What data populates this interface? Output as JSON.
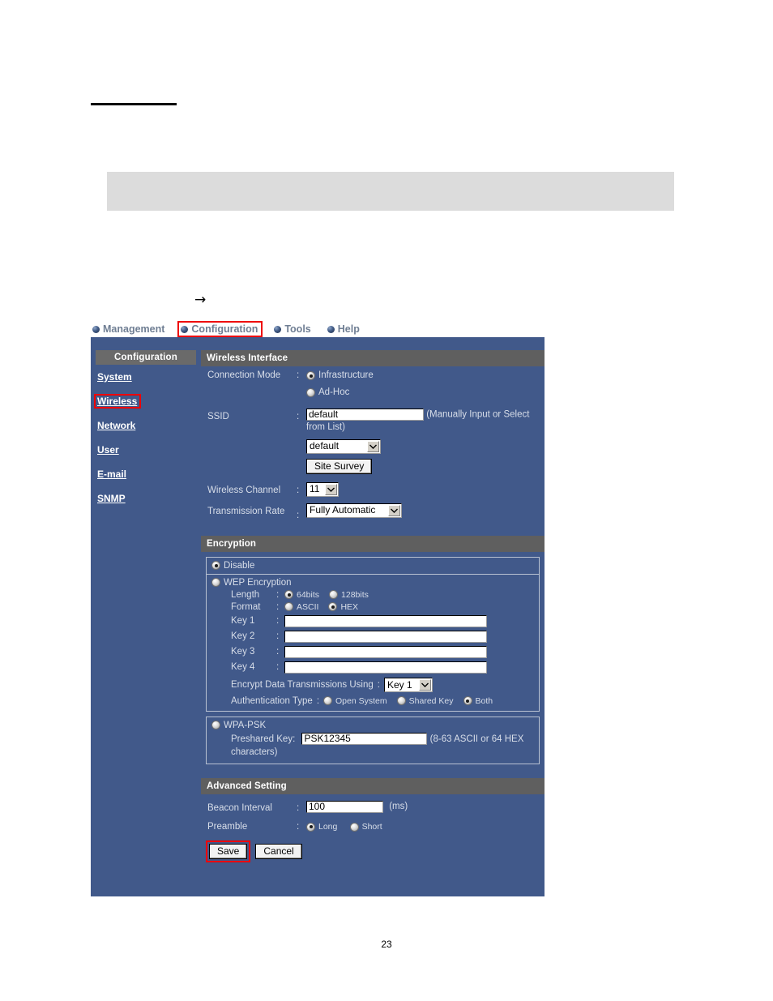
{
  "page": {
    "number": "23"
  },
  "annotation": {
    "arrow": "→",
    "accent_color": "#ee0000"
  },
  "topnav": {
    "items": [
      {
        "label": "Management",
        "icon": "blue-sphere-bullet-icon",
        "highlighted": false
      },
      {
        "label": "Configuration",
        "icon": "blue-sphere-bullet-icon",
        "highlighted": true
      },
      {
        "label": "Tools",
        "icon": "blue-sphere-bullet-icon",
        "highlighted": false
      },
      {
        "label": "Help",
        "icon": "blue-sphere-bullet-icon",
        "highlighted": false
      }
    ]
  },
  "sidebar": {
    "header": "Configuration",
    "items": [
      {
        "label": "System",
        "highlighted": false
      },
      {
        "label": "Wireless",
        "highlighted": true
      },
      {
        "label": "Network",
        "highlighted": false
      },
      {
        "label": "User",
        "highlighted": false
      },
      {
        "label": "E-mail",
        "highlighted": false
      },
      {
        "label": "SNMP",
        "highlighted": false
      }
    ]
  },
  "wireless_interface": {
    "title": "Wireless Interface",
    "connection_mode": {
      "label": "Connection Mode",
      "colon": ":",
      "options": [
        {
          "label": "Infrastructure",
          "selected": true
        },
        {
          "label": "Ad-Hoc",
          "selected": false
        }
      ]
    },
    "ssid": {
      "label": "SSID",
      "colon": ":",
      "value": "default",
      "hint": "(Manually Input or Select from List)",
      "select_value": "default",
      "site_survey_button": "Site Survey"
    },
    "wireless_channel": {
      "label": "Wireless Channel",
      "colon": ":",
      "value": "11"
    },
    "transmission_rate": {
      "label": "Transmission Rate",
      "colon": ":",
      "value": "Fully Automatic"
    }
  },
  "encryption": {
    "title": "Encryption",
    "disable": {
      "label": "Disable",
      "selected": true
    },
    "wep": {
      "label": "WEP Encryption",
      "selected": false,
      "length": {
        "label": "Length",
        "colon": ":",
        "options": [
          {
            "label": "64bits",
            "selected": true
          },
          {
            "label": "128bits",
            "selected": false
          }
        ]
      },
      "format": {
        "label": "Format",
        "colon": ":",
        "options": [
          {
            "label": "ASCII",
            "selected": false
          },
          {
            "label": "HEX",
            "selected": true
          }
        ]
      },
      "keys": [
        {
          "label": "Key 1",
          "colon": ":",
          "value": ""
        },
        {
          "label": "Key 2",
          "colon": ":",
          "value": ""
        },
        {
          "label": "Key 3",
          "colon": ":",
          "value": ""
        },
        {
          "label": "Key 4",
          "colon": ":",
          "value": ""
        }
      ],
      "encrypt_using": {
        "label": "Encrypt Data Transmissions Using",
        "colon": ":",
        "value": "Key 1"
      },
      "auth_type": {
        "label": "Authentication Type",
        "colon": ":",
        "options": [
          {
            "label": "Open System",
            "selected": false
          },
          {
            "label": "Shared Key",
            "selected": false
          },
          {
            "label": "Both",
            "selected": true
          }
        ]
      }
    },
    "wpa_psk": {
      "label": "WPA-PSK",
      "selected": false,
      "preshared_key": {
        "label": "Preshared Key:",
        "value": "PSK12345",
        "hint": "(8-63 ASCII or 64 HEX characters)"
      }
    }
  },
  "advanced_setting": {
    "title": "Advanced Setting",
    "beacon_interval": {
      "label": "Beacon Interval",
      "colon": ":",
      "value": "100",
      "unit": "(ms)"
    },
    "preamble": {
      "label": "Preamble",
      "colon": ":",
      "options": [
        {
          "label": "Long",
          "selected": true
        },
        {
          "label": "Short",
          "selected": false
        }
      ]
    }
  },
  "actions": {
    "save": "Save",
    "cancel": "Cancel"
  }
}
